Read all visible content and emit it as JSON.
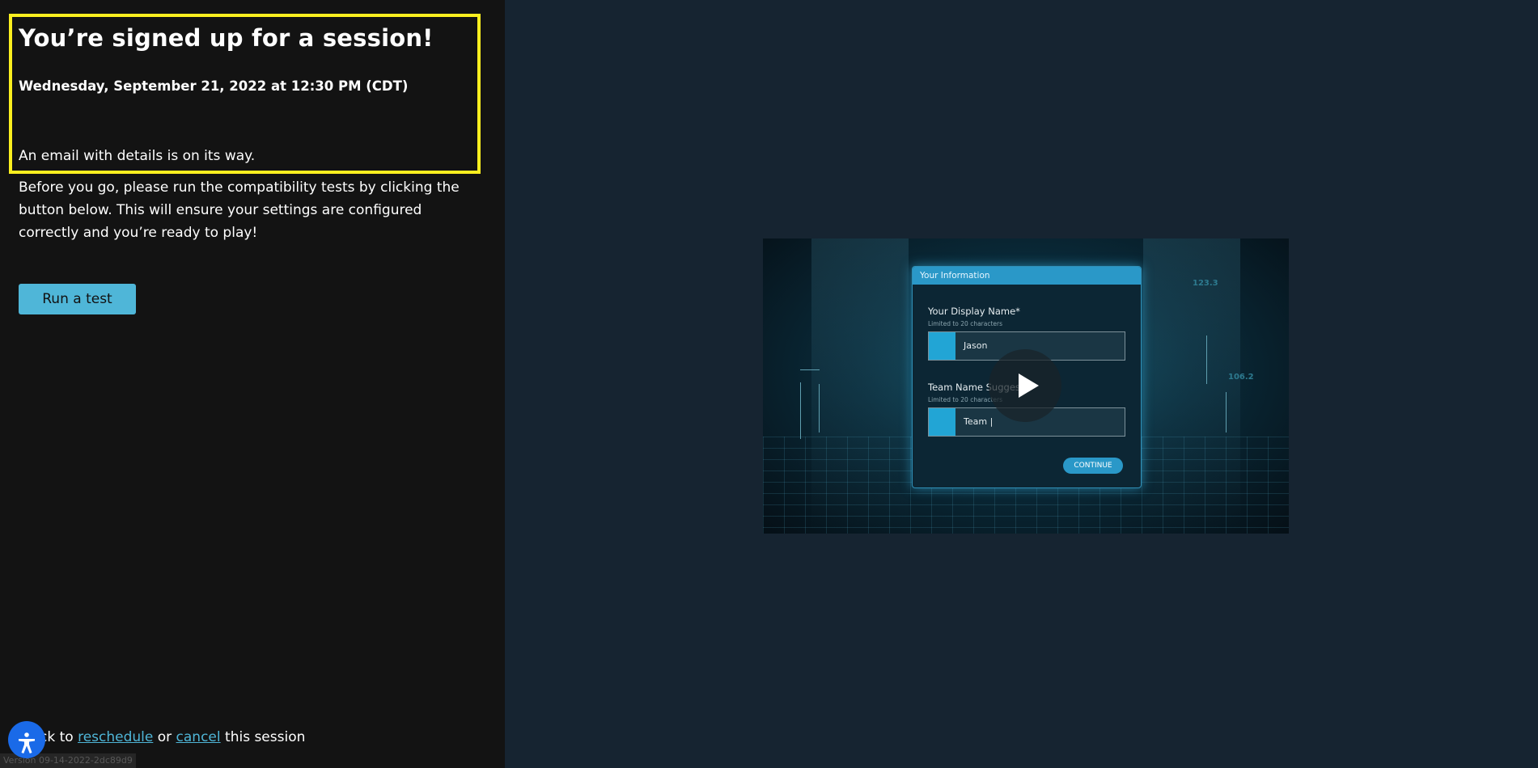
{
  "confirmation": {
    "title": "You’re signed up for a session!",
    "datetime": "Wednesday, September 21, 2022 at 12:30 PM (CDT)",
    "email_note": "An email with details is on its way.",
    "instructions": "Before you go, please run the compatibility tests by clicking the button below. This will ensure your settings are configured correctly and you’re ready to play!",
    "run_test_label": "Run a test"
  },
  "footer": {
    "prefix": "ck to",
    "reschedule_label": "reschedule",
    "or_text": "or",
    "cancel_label": "cancel",
    "suffix": "this session",
    "version": "Version 09-14-2022-2dc89d9"
  },
  "video_preview": {
    "dialog_title": "Your Information",
    "display_name_label": "Your Display Name*",
    "display_name_hint": "Limited to 20 characters",
    "display_name_value": "Jason",
    "team_name_label": "Team Name Suggest",
    "team_name_hint": "Limited to 20 characters",
    "team_name_value": "Team |",
    "continue_label": "CONTINUE",
    "floating_numbers": [
      "123.3",
      "106.2"
    ]
  },
  "colors": {
    "left_bg": "#131313",
    "right_bg": "#162431",
    "highlight_border": "#fbef1f",
    "accent": "#4fb6d8",
    "accessibility": "#1a6ae8"
  },
  "icons": {
    "accessibility": "accessibility-icon",
    "play": "play-icon"
  }
}
